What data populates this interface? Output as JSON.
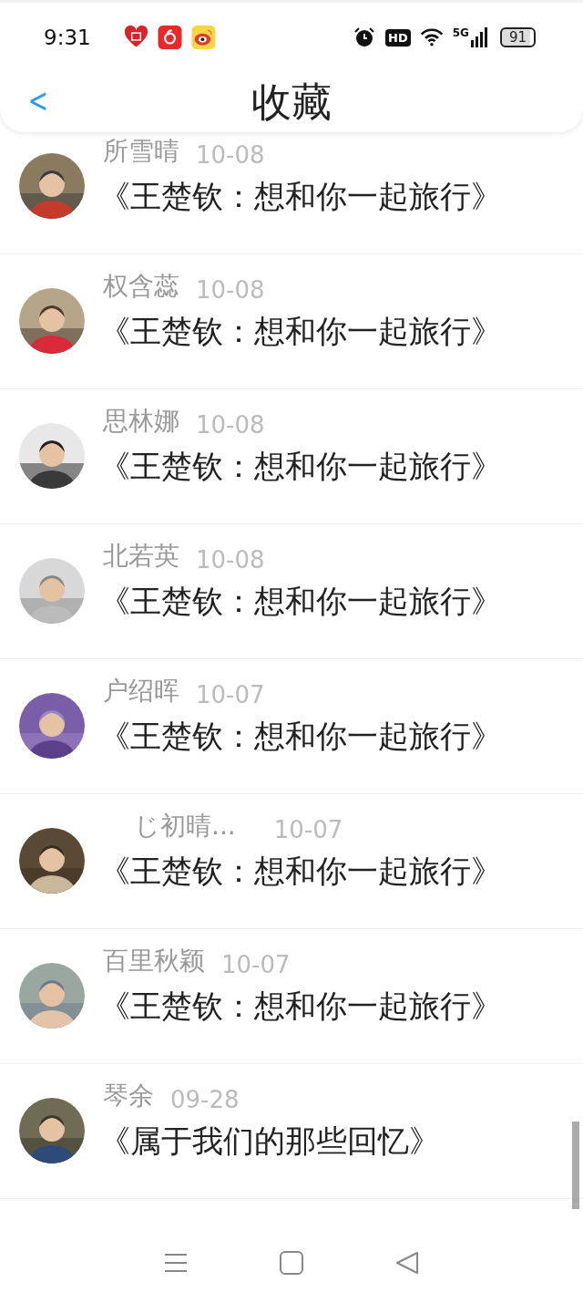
{
  "status_bar": {
    "time": "9:31",
    "battery": "91",
    "network": "5G",
    "hd": "HD"
  },
  "header": {
    "back": "<",
    "title": "收藏"
  },
  "rows": [
    {
      "name": "所雪晴",
      "date": "10-08",
      "title": "《王楚钦：想和你一起旅行》"
    },
    {
      "name": "权含蕊",
      "date": "10-08",
      "title": "《王楚钦：想和你一起旅行》"
    },
    {
      "name": "思林娜",
      "date": "10-08",
      "title": "《王楚钦：想和你一起旅行》"
    },
    {
      "name": "北若英",
      "date": "10-08",
      "title": "《王楚钦：想和你一起旅行》"
    },
    {
      "name": "户绍晖",
      "date": "10-07",
      "title": "《王楚钦：想和你一起旅行》"
    },
    {
      "name": "じ初晴...",
      "date": "10-07",
      "title": "《王楚钦：想和你一起旅行》"
    },
    {
      "name": "百里秋颖",
      "date": "10-07",
      "title": "《王楚钦：想和你一起旅行》"
    },
    {
      "name": "琴余",
      "date": "09-28",
      "title": "《属于我们的那些回忆》"
    }
  ]
}
